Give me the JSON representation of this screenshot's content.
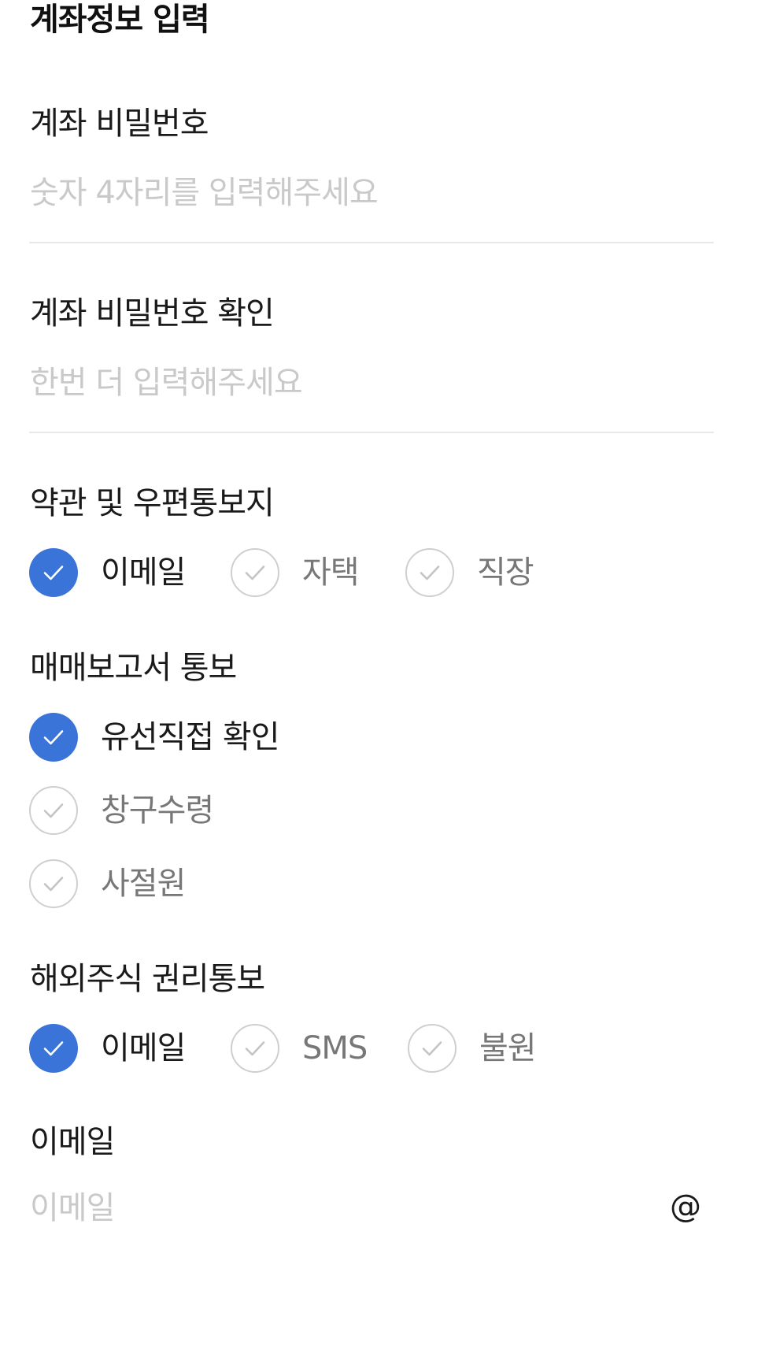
{
  "header": {
    "title": "계좌정보 입력"
  },
  "account_password": {
    "label": "계좌 비밀번호",
    "value": "",
    "placeholder": "숫자 4자리를 입력해주세요"
  },
  "account_password_confirm": {
    "label": "계좌 비밀번호 확인",
    "value": "",
    "placeholder": "한번 더 입력해주세요"
  },
  "terms_mail": {
    "label": "약관 및 우편통보지",
    "options": [
      {
        "label": "이메일",
        "checked": true
      },
      {
        "label": "자택",
        "checked": false
      },
      {
        "label": "직장",
        "checked": false
      }
    ]
  },
  "trade_report": {
    "label": "매매보고서 통보",
    "options": [
      {
        "label": "유선직접 확인",
        "checked": true
      },
      {
        "label": "창구수령",
        "checked": false
      },
      {
        "label": "사절원",
        "checked": false
      }
    ]
  },
  "foreign_rights": {
    "label": "해외주식 권리통보",
    "options": [
      {
        "label": "이메일",
        "checked": true
      },
      {
        "label": "SMS",
        "checked": false
      },
      {
        "label": "불원",
        "checked": false
      }
    ]
  },
  "email": {
    "label": "이메일",
    "value": "",
    "placeholder": "이메일",
    "at_symbol": "@"
  },
  "colors": {
    "accent": "#3b74d8",
    "placeholder": "#c9c9c9",
    "divider": "#e8e8e8",
    "unchecked_border": "#cfcfcf"
  },
  "icons": {
    "checked": "check-circle-filled-icon",
    "unchecked": "check-circle-outline-icon"
  }
}
